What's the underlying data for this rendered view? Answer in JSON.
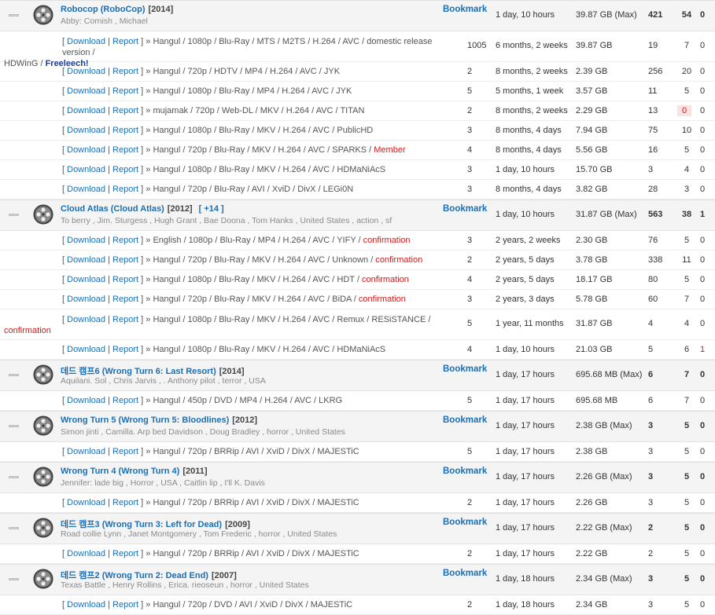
{
  "labels": {
    "download": "Download",
    "report": "Report",
    "bookmark": "Bookmark",
    "sep": "|",
    "lb": "[",
    "rb": "]",
    "arrow": "»",
    "more": "[ +14 ]"
  },
  "groups": [
    {
      "title": "Robocop (RoboCop)",
      "year": "[2014]",
      "cast": "Abby: Cornish , Michael",
      "time": "1 day, 10 hours",
      "size": "39.87 GB (Max)",
      "snatched": "421",
      "seeders": "54",
      "leechers": "0",
      "torrents": [
        {
          "edition": "Hangul / 1080p / Blu-Ray / MTS / M2TS / H.264 / AVC / domestic release version /",
          "wrap": "HDWinG / ",
          "tag": "Freeleech!",
          "files": "1005",
          "time": "6 months, 2 weeks",
          "size": "39.87 GB",
          "snatched": "19",
          "seeders": "7",
          "leechers": "0"
        },
        {
          "edition": "Hangul / 720p / HDTV / MP4 / H.264 / AVC / JYK",
          "files": "2",
          "time": "8 months, 2 weeks",
          "size": "2.39 GB",
          "snatched": "256",
          "seeders": "20",
          "leechers": "0"
        },
        {
          "edition": "Hangul / 1080p / Blu-Ray / MP4 / H.264 / AVC / JYK",
          "files": "5",
          "time": "5 months, 1 week",
          "size": "3.57 GB",
          "snatched": "11",
          "seeders": "5",
          "leechers": "0"
        },
        {
          "edition": "mujamak / 720p / Web-DL / MKV / H.264 / AVC / TITAN",
          "files": "2",
          "time": "8 months, 2 weeks",
          "size": "2.29 GB",
          "snatched": "13",
          "seeders": "0",
          "leechers": "0"
        },
        {
          "edition": "Hangul / 1080p / Blu-Ray / MKV / H.264 / AVC / PublicHD",
          "files": "3",
          "time": "8 months, 4 days",
          "size": "7.94 GB",
          "snatched": "75",
          "seeders": "10",
          "leechers": "0"
        },
        {
          "edition": "Hangul / 720p / Blu-Ray / MKV / H.264 / AVC / SPARKS / ",
          "warn": "Member",
          "files": "4",
          "time": "8 months, 4 days",
          "size": "5.56 GB",
          "snatched": "16",
          "seeders": "5",
          "leechers": "0"
        },
        {
          "edition": "Hangul / 1080p / Blu-Ray / MKV / H.264 / AVC / HDMaNiAcS",
          "files": "3",
          "time": "1 day, 10 hours",
          "size": "15.70 GB",
          "snatched": "3",
          "seeders": "4",
          "leechers": "0"
        },
        {
          "edition": "Hangul / 720p / Blu-Ray / AVI / XviD / DivX / LEGi0N",
          "files": "3",
          "time": "8 months, 4 days",
          "size": "3.82 GB",
          "snatched": "28",
          "seeders": "3",
          "leechers": "0"
        }
      ]
    },
    {
      "title": "Cloud Atlas (Cloud Atlas)",
      "year": "[2012]",
      "more": "[ +14 ]",
      "cast": "To berry , Jim. Sturgess , Hugh Grant , Bae Doona , Tom Hanks , United States , action , sf",
      "time": "1 day, 10 hours",
      "size": "31.87 GB (Max)",
      "snatched": "563",
      "seeders": "38",
      "leechers": "1",
      "torrents": [
        {
          "edition": "English / 1080p / Blu-Ray / MP4 / H.264 / AVC / YIFY / ",
          "warn": "confirmation",
          "files": "3",
          "time": "2 years, 2 weeks",
          "size": "2.30 GB",
          "snatched": "76",
          "seeders": "5",
          "leechers": "0"
        },
        {
          "edition": "Hangul / 720p / Blu-Ray / MKV / H.264 / AVC / Unknown / ",
          "warn": "confirmation",
          "files": "2",
          "time": "2 years, 5 days",
          "size": "3.78 GB",
          "snatched": "338",
          "seeders": "11",
          "leechers": "0"
        },
        {
          "edition": "Hangul / 1080p / Blu-Ray / MKV / H.264 / AVC / HDT / ",
          "warn": "confirmation",
          "files": "4",
          "time": "2 years, 5 days",
          "size": "18.17 GB",
          "snatched": "80",
          "seeders": "5",
          "leechers": "0"
        },
        {
          "edition": "Hangul / 720p / Blu-Ray / MKV / H.264 / AVC / BiDA / ",
          "warn": "confirmation",
          "files": "3",
          "time": "2 years, 3 days",
          "size": "5.78 GB",
          "snatched": "60",
          "seeders": "7",
          "leechers": "0"
        },
        {
          "edition": "Hangul / 1080p / Blu-Ray / MKV / H.264 / AVC / Remux / RESiSTANCE /",
          "wrapwarn": "confirmation",
          "files": "5",
          "time": "1 year, 11 months",
          "size": "31.87 GB",
          "snatched": "4",
          "seeders": "4",
          "leechers": "0"
        },
        {
          "edition": "Hangul / 1080p / Blu-Ray / MKV / H.264 / AVC / HDMaNiAcS",
          "files": "4",
          "time": "1 day, 10 hours",
          "size": "21.03 GB",
          "snatched": "5",
          "seeders": "6",
          "leechers": "1"
        }
      ]
    },
    {
      "title": "데드 캠프6 (Wrong Turn 6: Last Resort)",
      "year": "[2014]",
      "cast": "Aquilani. Sol , Chris Jarvis , . Anthony pilot , terror , USA",
      "time": "1 day, 17 hours",
      "size": "695.68 MB (Max)",
      "snatched": "6",
      "seeders": "7",
      "leechers": "0",
      "torrents": [
        {
          "edition": "Hangul / 450p / DVD / MP4 / H.264 / AVC / LKRG",
          "files": "5",
          "time": "1 day, 17 hours",
          "size": "695.68 MB",
          "snatched": "6",
          "seeders": "7",
          "leechers": "0"
        }
      ]
    },
    {
      "title": "Wrong Turn 5 (Wrong Turn 5: Bloodlines)",
      "year": "[2012]",
      "cast": "Simon jinti , Camilla. Arp bed Davidson , Doug Bradley , horror , United States",
      "time": "1 day, 17 hours",
      "size": "2.38 GB (Max)",
      "snatched": "3",
      "seeders": "5",
      "leechers": "0",
      "torrents": [
        {
          "edition": "Hangul / 720p / BRRip / AVI / XviD / DivX / MAJESTiC",
          "files": "5",
          "time": "1 day, 17 hours",
          "size": "2.38 GB",
          "snatched": "3",
          "seeders": "5",
          "leechers": "0"
        }
      ]
    },
    {
      "title": "Wrong Turn 4 (Wrong Turn 4)",
      "year": "[2011]",
      "cast": "Jennifer: lade big , Horror , USA , Caitlin lip , I'll K. Davis",
      "time": "1 day, 17 hours",
      "size": "2.26 GB (Max)",
      "snatched": "3",
      "seeders": "5",
      "leechers": "0",
      "torrents": [
        {
          "edition": "Hangul / 720p / BRRip / AVI / XviD / DivX / MAJESTiC",
          "files": "2",
          "time": "1 day, 17 hours",
          "size": "2.26 GB",
          "snatched": "3",
          "seeders": "5",
          "leechers": "0"
        }
      ]
    },
    {
      "title": "데드 캠프3 (Wrong Turn 3: Left for Dead)",
      "year": "[2009]",
      "cast": "Road collie Lynn , Janet Montgomery , Tom Frederic , horror , United States",
      "time": "1 day, 17 hours",
      "size": "2.22 GB (Max)",
      "snatched": "2",
      "seeders": "5",
      "leechers": "0",
      "torrents": [
        {
          "edition": "Hangul / 720p / BRRip / AVI / XviD / DivX / MAJESTiC",
          "files": "2",
          "time": "1 day, 17 hours",
          "size": "2.22 GB",
          "snatched": "2",
          "seeders": "5",
          "leechers": "0"
        }
      ]
    },
    {
      "title": "데드 캠프2 (Wrong Turn 2: Dead End)",
      "year": "[2007]",
      "cast": "Texas Battle , Henry Rollins , Erica. rieoseun , horror , United States",
      "time": "1 day, 18 hours",
      "size": "2.34 GB (Max)",
      "snatched": "3",
      "seeders": "5",
      "leechers": "0",
      "torrents": [
        {
          "edition": "Hangul / 720p / DVD / AVI / XviD / DivX / MAJESTiC",
          "files": "2",
          "time": "1 day, 18 hours",
          "size": "2.34 GB",
          "snatched": "3",
          "seeders": "5",
          "leechers": "0"
        }
      ]
    }
  ]
}
